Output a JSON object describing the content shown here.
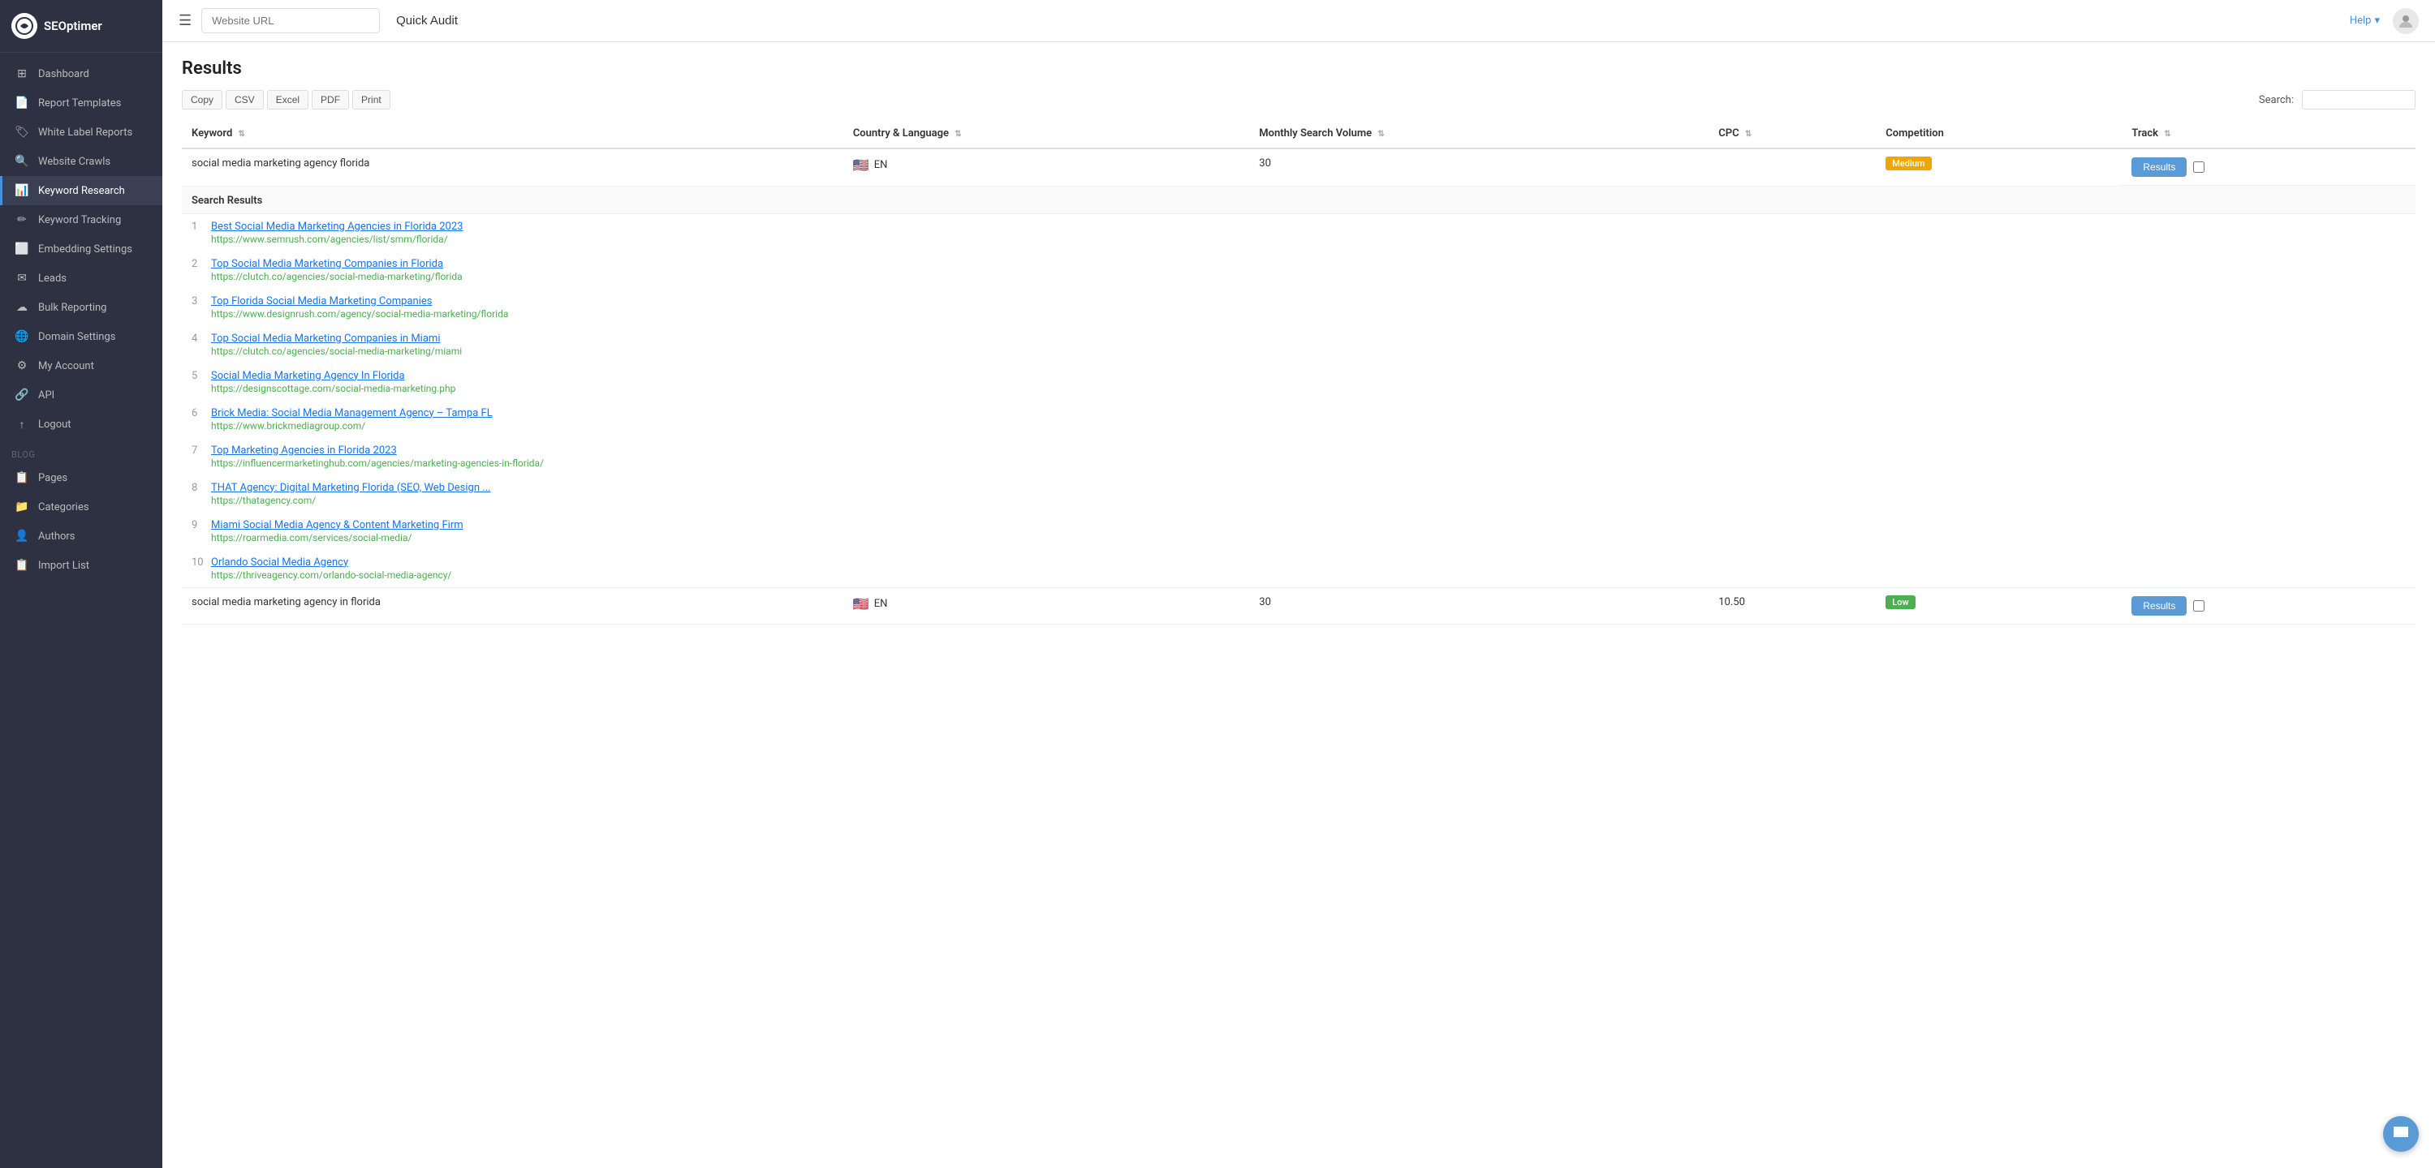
{
  "brand": {
    "name": "SEOptimer",
    "logo_symbol": "⚙"
  },
  "sidebar": {
    "items": [
      {
        "id": "dashboard",
        "label": "Dashboard",
        "icon": "⊞",
        "active": false
      },
      {
        "id": "report-templates",
        "label": "Report Templates",
        "icon": "📄",
        "active": false
      },
      {
        "id": "white-label-reports",
        "label": "White Label Reports",
        "icon": "🏷",
        "active": false
      },
      {
        "id": "website-crawls",
        "label": "Website Crawls",
        "icon": "🔍",
        "active": false
      },
      {
        "id": "keyword-research",
        "label": "Keyword Research",
        "icon": "📊",
        "active": true
      },
      {
        "id": "keyword-tracking",
        "label": "Keyword Tracking",
        "icon": "✏",
        "active": false
      },
      {
        "id": "embedding-settings",
        "label": "Embedding Settings",
        "icon": "⬜",
        "active": false
      },
      {
        "id": "leads",
        "label": "Leads",
        "icon": "✉",
        "active": false
      },
      {
        "id": "bulk-reporting",
        "label": "Bulk Reporting",
        "icon": "☁",
        "active": false
      },
      {
        "id": "domain-settings",
        "label": "Domain Settings",
        "icon": "🌐",
        "active": false
      },
      {
        "id": "my-account",
        "label": "My Account",
        "icon": "⚙",
        "active": false
      },
      {
        "id": "api",
        "label": "API",
        "icon": "🔗",
        "active": false
      },
      {
        "id": "logout",
        "label": "Logout",
        "icon": "↑",
        "active": false
      }
    ],
    "blog_section": "Blog",
    "blog_items": [
      {
        "id": "pages",
        "label": "Pages",
        "icon": "📋"
      },
      {
        "id": "categories",
        "label": "Categories",
        "icon": "📁"
      },
      {
        "id": "authors",
        "label": "Authors",
        "icon": "👤"
      },
      {
        "id": "import-list",
        "label": "Import List",
        "icon": "📋"
      }
    ]
  },
  "topbar": {
    "url_placeholder": "Website URL",
    "quick_audit_label": "Quick Audit",
    "help_label": "Help",
    "help_dropdown_icon": "▾"
  },
  "main": {
    "results_title": "Results",
    "table_controls": {
      "copy": "Copy",
      "csv": "CSV",
      "excel": "Excel",
      "pdf": "PDF",
      "print": "Print",
      "search_label": "Search:"
    },
    "table_headers": [
      {
        "id": "keyword",
        "label": "Keyword"
      },
      {
        "id": "country-language",
        "label": "Country & Language"
      },
      {
        "id": "monthly-search-volume",
        "label": "Monthly Search Volume"
      },
      {
        "id": "cpc",
        "label": "CPC"
      },
      {
        "id": "competition",
        "label": "Competition"
      },
      {
        "id": "track",
        "label": "Track"
      }
    ],
    "keyword_rows": [
      {
        "keyword": "social media marketing agency florida",
        "country": "EN",
        "flag": "🇺🇸",
        "monthly_volume": "30",
        "cpc": "",
        "competition": "Medium",
        "competition_color": "medium",
        "results_btn": "Results",
        "expanded": true,
        "search_results": {
          "header": "Search Results",
          "items": [
            {
              "num": 1,
              "title": "Best Social Media Marketing Agencies in Florida 2023",
              "url": "https://www.semrush.com/agencies/list/smm/florida/"
            },
            {
              "num": 2,
              "title": "Top Social Media Marketing Companies in Florida",
              "url": "https://clutch.co/agencies/social-media-marketing/florida"
            },
            {
              "num": 3,
              "title": "Top Florida Social Media Marketing Companies",
              "url": "https://www.designrush.com/agency/social-media-marketing/florida"
            },
            {
              "num": 4,
              "title": "Top Social Media Marketing Companies in Miami",
              "url": "https://clutch.co/agencies/social-media-marketing/miami"
            },
            {
              "num": 5,
              "title": "Social Media Marketing Agency In Florida",
              "url": "https://designscottage.com/social-media-marketing.php"
            },
            {
              "num": 6,
              "title": "Brick Media: Social Media Management Agency – Tampa FL",
              "url": "https://www.brickmediagroup.com/"
            },
            {
              "num": 7,
              "title": "Top Marketing Agencies in Florida 2023",
              "url": "https://influencermarketinghub.com/agencies/marketing-agencies-in-florida/"
            },
            {
              "num": 8,
              "title": "THAT Agency: Digital Marketing Florida (SEO, Web Design ...",
              "url": "https://thatagency.com/"
            },
            {
              "num": 9,
              "title": "Miami Social Media Agency & Content Marketing Firm",
              "url": "https://roarmedia.com/services/social-media/"
            },
            {
              "num": 10,
              "title": "Orlando Social Media Agency",
              "url": "https://thriveagency.com/orlando-social-media-agency/"
            }
          ]
        }
      },
      {
        "keyword": "social media marketing agency in florida",
        "country": "EN",
        "flag": "🇺🇸",
        "monthly_volume": "30",
        "cpc": "10.50",
        "competition": "Low",
        "competition_color": "low",
        "results_btn": "Results",
        "expanded": false
      }
    ]
  }
}
